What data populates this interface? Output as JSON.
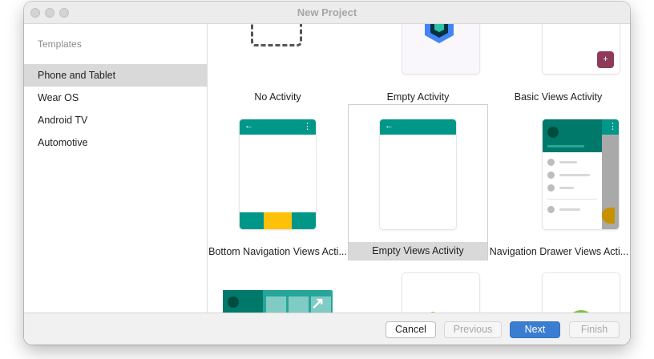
{
  "window": {
    "title": "New Project"
  },
  "sidebar": {
    "title": "Templates",
    "items": [
      {
        "label": "Phone and Tablet",
        "selected": true
      },
      {
        "label": "Wear OS",
        "selected": false
      },
      {
        "label": "Android TV",
        "selected": false
      },
      {
        "label": "Automotive",
        "selected": false
      }
    ]
  },
  "templates": {
    "row1": [
      "No Activity",
      "Empty Activity",
      "Basic Views Activity"
    ],
    "row2": [
      "Bottom Navigation Views Acti...",
      "Empty Views Activity",
      "Navigation Drawer Views Acti..."
    ],
    "selected": "Empty Views Activity"
  },
  "icons": {
    "back": "←",
    "overflow": "⋮",
    "plus": "+",
    "expand": "↗"
  },
  "footer": {
    "cancel": "Cancel",
    "previous": "Previous",
    "next": "Next",
    "finish": "Finish"
  },
  "colors": {
    "teal": "#009688",
    "dark_teal": "#00796b",
    "accent_yellow": "#ffc107",
    "primary_button": "#3b7ed1",
    "selection": "#d9d9d9",
    "fab_plum": "#8e3b5a"
  }
}
